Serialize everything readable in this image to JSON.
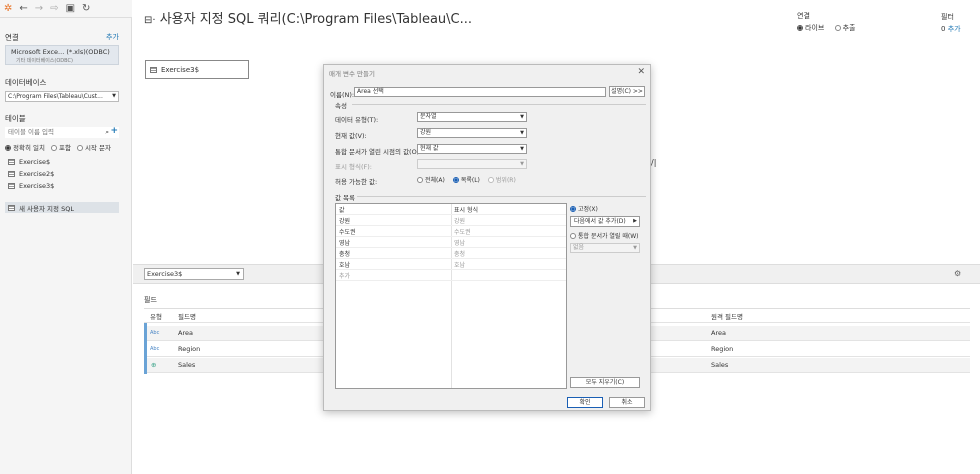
{
  "sidebar": {
    "connections_header": "연결",
    "add_link": "추가",
    "connection_name": "Microsoft Exce... (*.xls)(ODBC)",
    "connection_sub": "기타 데이터베이스(ODBC)",
    "database_header": "데이터베이스",
    "database_value": "C:\\Program Files\\Tableau\\Cust...",
    "tables_header": "테이블",
    "table_search_placeholder": "테이블 이름 입력",
    "match_options": [
      "정확히 일치",
      "포함",
      "시작 문자"
    ],
    "tables": [
      "Exercise$",
      "Exercise2$",
      "Exercise3$"
    ],
    "new_custom_sql": "새 사용자 지정 SQL"
  },
  "header": {
    "title": "사용자 지정 SQL 쿼리(C:\\Program Files\\Tableau\\C...",
    "connection_label": "연결",
    "live_label": "라이브",
    "extract_label": "추출",
    "filter_label": "필터",
    "filter_count": "0",
    "filter_add": "추가"
  },
  "canvas": {
    "node_label": "Exercise3$"
  },
  "grid": {
    "table_select": "Exercise3$",
    "fields_header": "필드",
    "columns": [
      "유형",
      "필드명",
      "원격 필드명"
    ],
    "rows": [
      {
        "type": "Abc",
        "field": "Area",
        "remote": "Area"
      },
      {
        "type": "Abc",
        "field": "Region",
        "remote": "Region"
      },
      {
        "type": "⊕",
        "field": "Sales",
        "remote": "Sales"
      }
    ]
  },
  "dialog": {
    "title": "매개 변수 만들기",
    "name_label": "이름(N):",
    "name_value": "Area 선택",
    "comment_button": "설명(C) >>",
    "properties_header": "속성",
    "data_type_label": "데이터 유형(T):",
    "data_type_value": "문자열",
    "current_value_label": "현재 값(V):",
    "current_value_value": "강원",
    "workbook_open_label": "통합 문서가 열린 시점의 값(O):",
    "workbook_open_value": "현재 값",
    "display_format_label": "표시 형식(F):",
    "allowable_label": "허용 가능한 값:",
    "allowable_options": [
      "전체(A)",
      "목록(L)",
      "범위(R)"
    ],
    "value_list_header": "값 목록",
    "list_columns": [
      "값",
      "표시 형식"
    ],
    "list_rows": [
      {
        "value": "강원",
        "display": "강원"
      },
      {
        "value": "수도권",
        "display": "수도권"
      },
      {
        "value": "영남",
        "display": "영남"
      },
      {
        "value": "충청",
        "display": "충청"
      },
      {
        "value": "호남",
        "display": "호남"
      }
    ],
    "add_placeholder": "추가",
    "fixed_label": "고정(X)",
    "add_from_button": "다음에서 값 추가(D)",
    "when_open_label": "통합 문서가 열릴 때(W)",
    "none_value": "없음",
    "clear_all_button": "모두 지우기(C)",
    "ok_button": "확인",
    "cancel_button": "취소"
  }
}
